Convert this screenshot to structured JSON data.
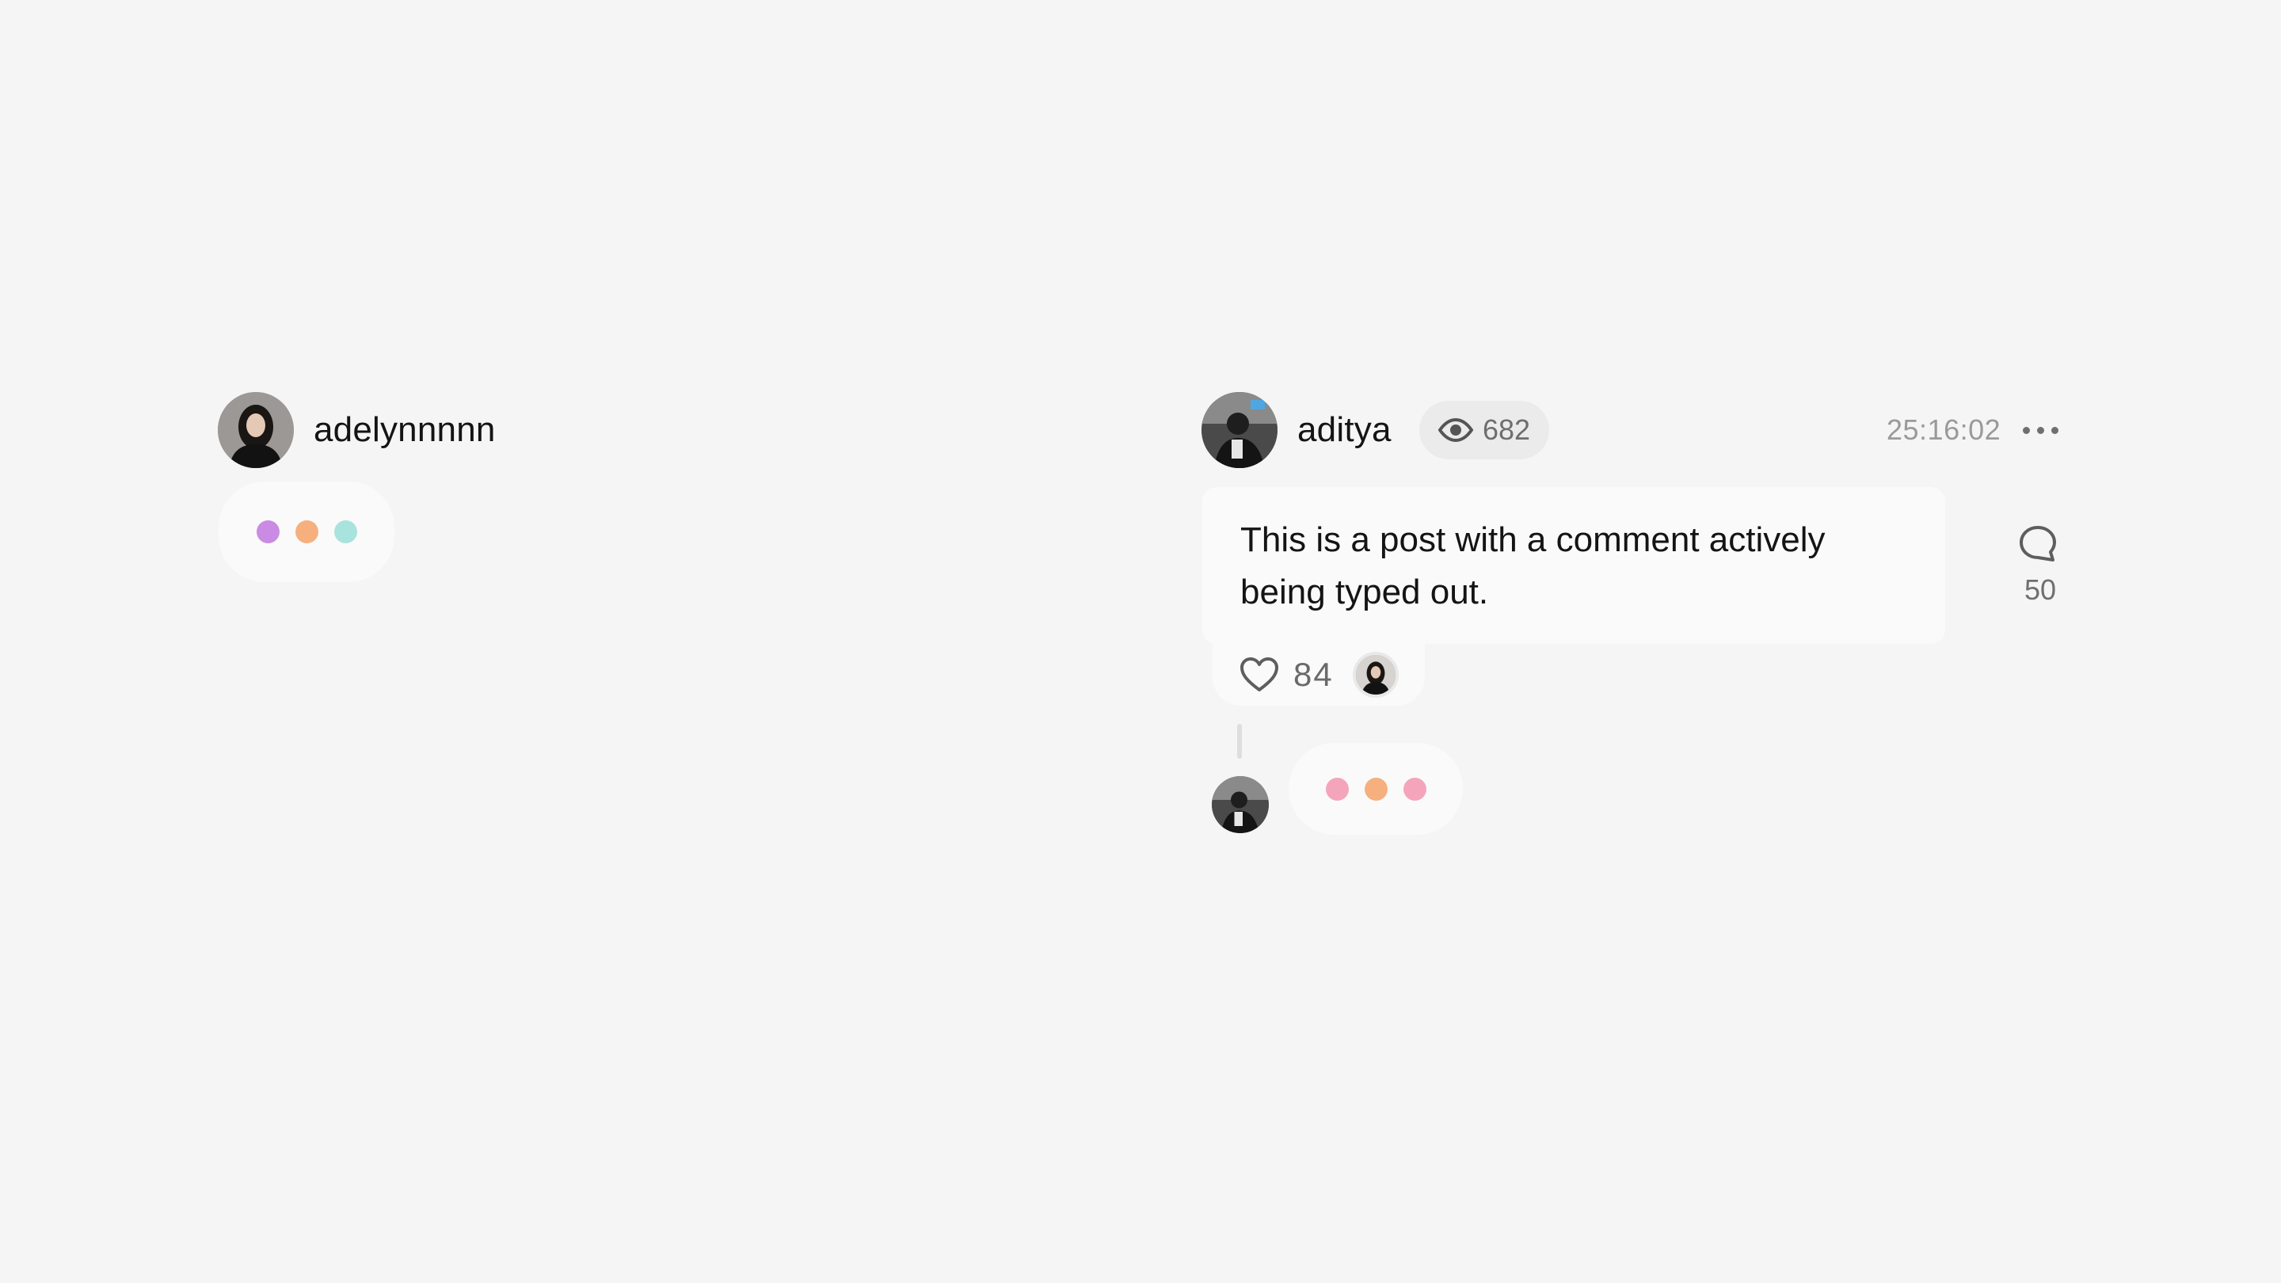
{
  "left_typing": {
    "username": "adelynnnnn",
    "avatar": "woman-portrait-avatar",
    "dots": [
      "#c98be3",
      "#f6b07d",
      "#a9e3de"
    ]
  },
  "post": {
    "username": "aditya",
    "avatar": "man-portrait-avatar",
    "views_icon": "eye-icon",
    "views": "682",
    "timestamp": "25:16:02",
    "more_icon": "more-horizontal-icon",
    "text_line1": "This is a post with a comment actively",
    "text_line2": "being typed out.",
    "likes": "84",
    "like_icon": "heart-icon",
    "comment_icon": "comment-bubble-icon",
    "comments": "50",
    "reply_typing_dots": [
      "#f4a5bb",
      "#f6b07d",
      "#f4a5bb"
    ]
  }
}
